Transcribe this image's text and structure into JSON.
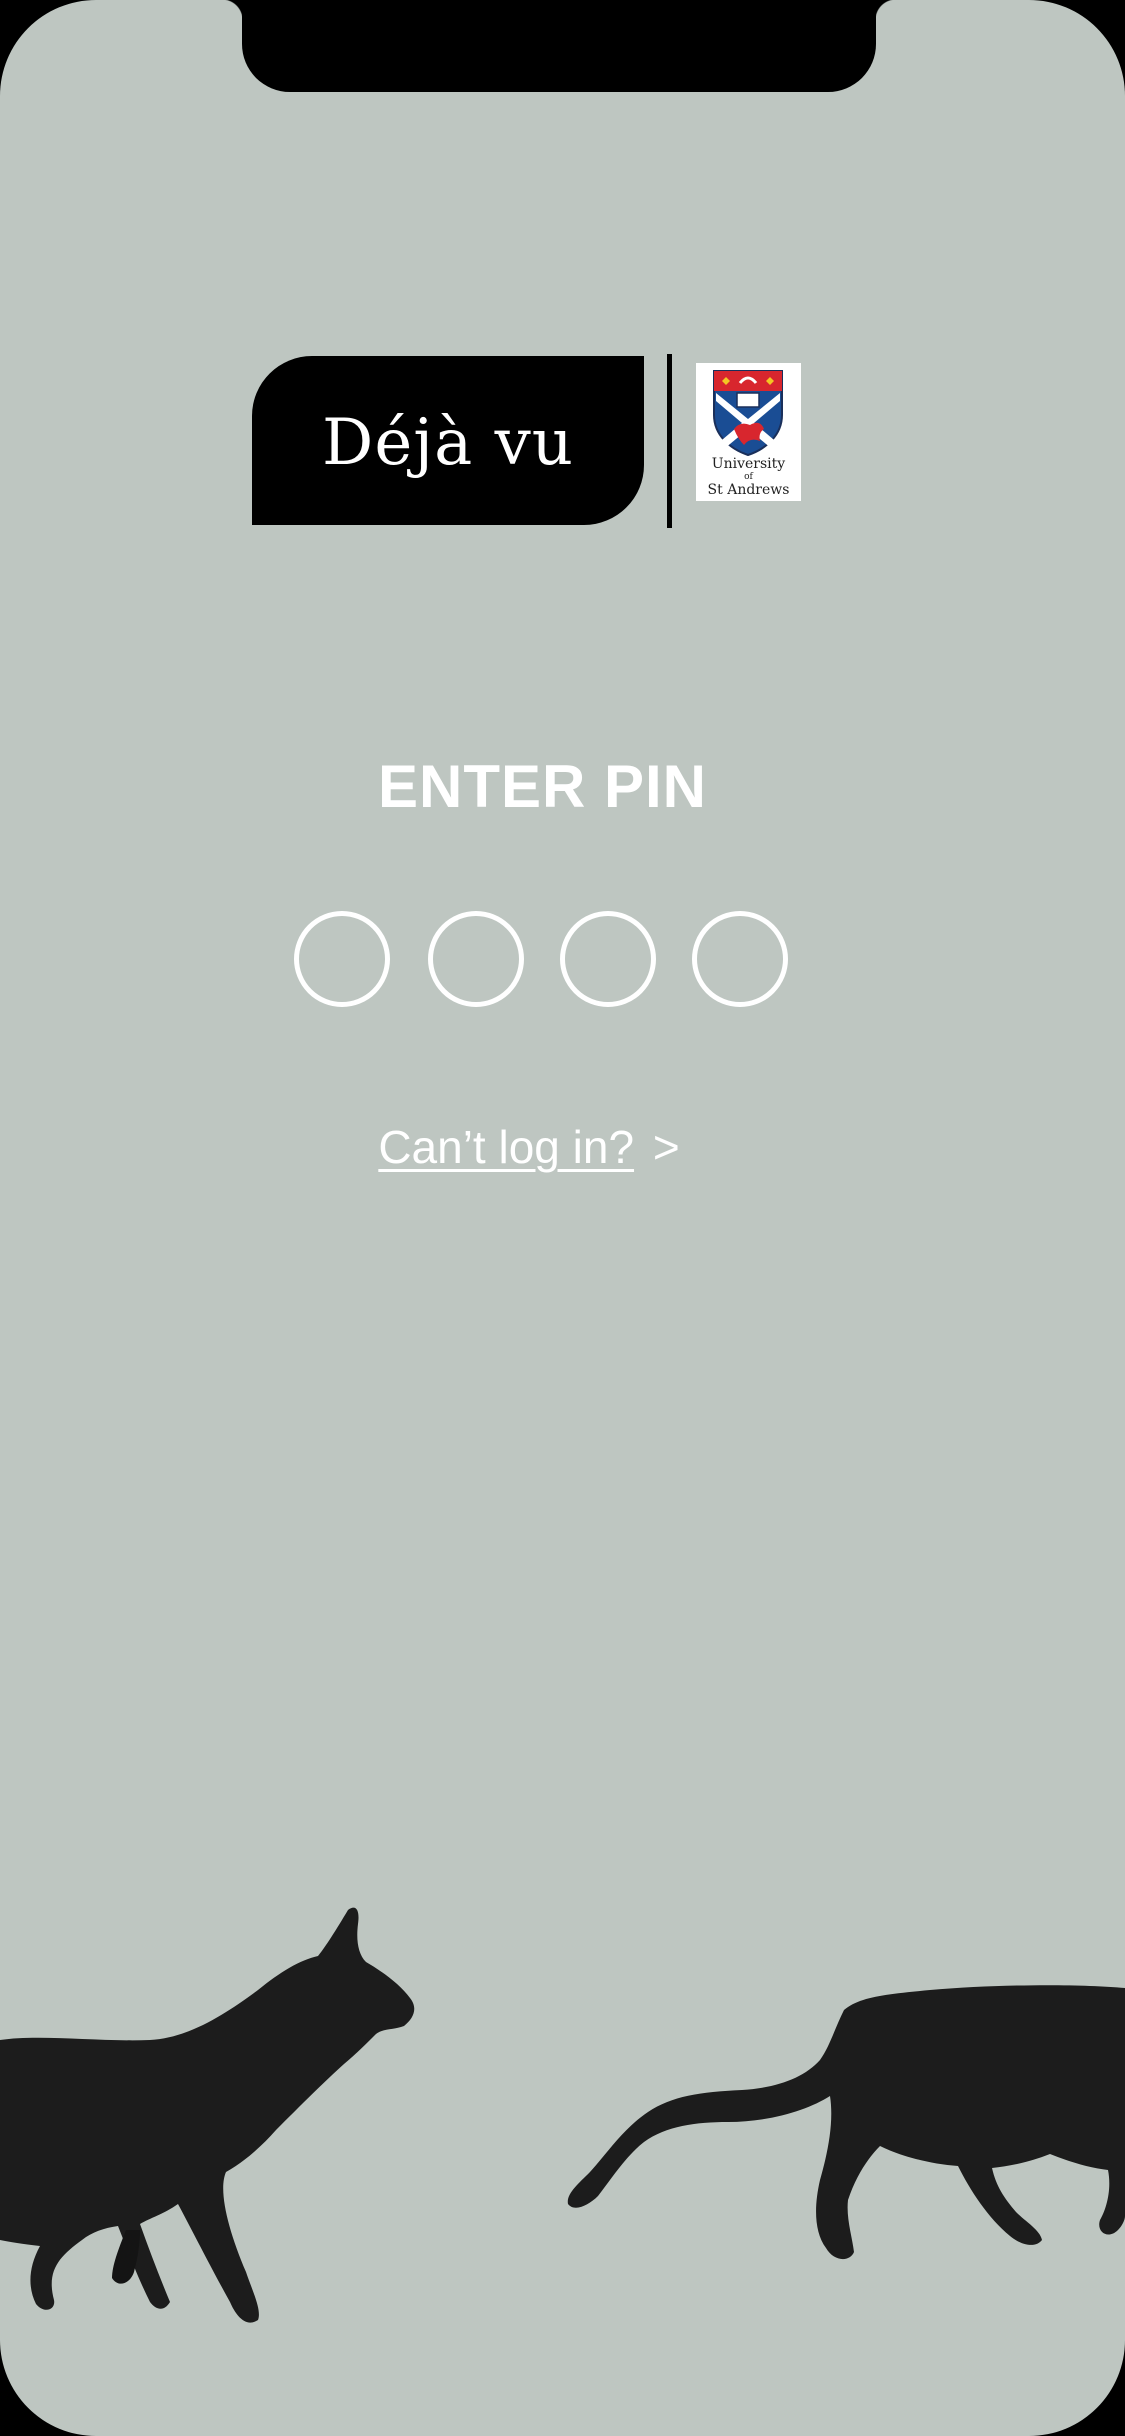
{
  "brand": {
    "app_name": "Déjà vu",
    "partner_line1": "University",
    "partner_line2": "of",
    "partner_line3": "St Andrews"
  },
  "pin": {
    "title": "ENTER PIN",
    "digits_total": 4,
    "digits_entered": 0
  },
  "help": {
    "link_label": "Can’t log in?",
    "chevron": ">"
  },
  "colors": {
    "background": "#bec6c1",
    "text": "#ffffff",
    "brand_pill": "#000000"
  },
  "icons": [
    "university-crest-icon",
    "cat-silhouette-icon"
  ]
}
